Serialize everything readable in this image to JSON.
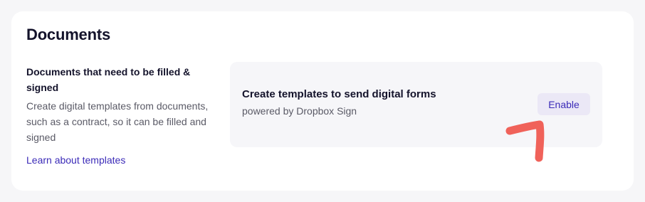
{
  "card": {
    "title": "Documents"
  },
  "section": {
    "heading": "Documents that need to be filled & signed",
    "description": "Create digital templates from documents, such as a contract, so it can be filled and signed",
    "link_label": "Learn about templates"
  },
  "feature": {
    "title": "Create templates to send digital forms",
    "subtitle": "powered by Dropbox Sign",
    "button_label": "Enable"
  },
  "colors": {
    "accent": "#3b2bb8",
    "annotation": "#f0625a"
  }
}
